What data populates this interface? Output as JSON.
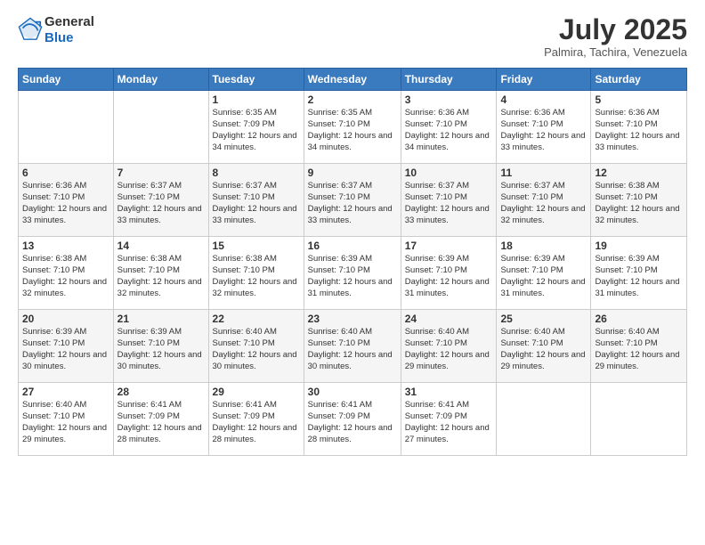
{
  "logo": {
    "general": "General",
    "blue": "Blue"
  },
  "title": "July 2025",
  "location": "Palmira, Tachira, Venezuela",
  "days_of_week": [
    "Sunday",
    "Monday",
    "Tuesday",
    "Wednesday",
    "Thursday",
    "Friday",
    "Saturday"
  ],
  "weeks": [
    [
      {
        "day": "",
        "info": ""
      },
      {
        "day": "",
        "info": ""
      },
      {
        "day": "1",
        "info": "Sunrise: 6:35 AM\nSunset: 7:09 PM\nDaylight: 12 hours and 34 minutes."
      },
      {
        "day": "2",
        "info": "Sunrise: 6:35 AM\nSunset: 7:10 PM\nDaylight: 12 hours and 34 minutes."
      },
      {
        "day": "3",
        "info": "Sunrise: 6:36 AM\nSunset: 7:10 PM\nDaylight: 12 hours and 34 minutes."
      },
      {
        "day": "4",
        "info": "Sunrise: 6:36 AM\nSunset: 7:10 PM\nDaylight: 12 hours and 33 minutes."
      },
      {
        "day": "5",
        "info": "Sunrise: 6:36 AM\nSunset: 7:10 PM\nDaylight: 12 hours and 33 minutes."
      }
    ],
    [
      {
        "day": "6",
        "info": "Sunrise: 6:36 AM\nSunset: 7:10 PM\nDaylight: 12 hours and 33 minutes."
      },
      {
        "day": "7",
        "info": "Sunrise: 6:37 AM\nSunset: 7:10 PM\nDaylight: 12 hours and 33 minutes."
      },
      {
        "day": "8",
        "info": "Sunrise: 6:37 AM\nSunset: 7:10 PM\nDaylight: 12 hours and 33 minutes."
      },
      {
        "day": "9",
        "info": "Sunrise: 6:37 AM\nSunset: 7:10 PM\nDaylight: 12 hours and 33 minutes."
      },
      {
        "day": "10",
        "info": "Sunrise: 6:37 AM\nSunset: 7:10 PM\nDaylight: 12 hours and 33 minutes."
      },
      {
        "day": "11",
        "info": "Sunrise: 6:37 AM\nSunset: 7:10 PM\nDaylight: 12 hours and 32 minutes."
      },
      {
        "day": "12",
        "info": "Sunrise: 6:38 AM\nSunset: 7:10 PM\nDaylight: 12 hours and 32 minutes."
      }
    ],
    [
      {
        "day": "13",
        "info": "Sunrise: 6:38 AM\nSunset: 7:10 PM\nDaylight: 12 hours and 32 minutes."
      },
      {
        "day": "14",
        "info": "Sunrise: 6:38 AM\nSunset: 7:10 PM\nDaylight: 12 hours and 32 minutes."
      },
      {
        "day": "15",
        "info": "Sunrise: 6:38 AM\nSunset: 7:10 PM\nDaylight: 12 hours and 32 minutes."
      },
      {
        "day": "16",
        "info": "Sunrise: 6:39 AM\nSunset: 7:10 PM\nDaylight: 12 hours and 31 minutes."
      },
      {
        "day": "17",
        "info": "Sunrise: 6:39 AM\nSunset: 7:10 PM\nDaylight: 12 hours and 31 minutes."
      },
      {
        "day": "18",
        "info": "Sunrise: 6:39 AM\nSunset: 7:10 PM\nDaylight: 12 hours and 31 minutes."
      },
      {
        "day": "19",
        "info": "Sunrise: 6:39 AM\nSunset: 7:10 PM\nDaylight: 12 hours and 31 minutes."
      }
    ],
    [
      {
        "day": "20",
        "info": "Sunrise: 6:39 AM\nSunset: 7:10 PM\nDaylight: 12 hours and 30 minutes."
      },
      {
        "day": "21",
        "info": "Sunrise: 6:39 AM\nSunset: 7:10 PM\nDaylight: 12 hours and 30 minutes."
      },
      {
        "day": "22",
        "info": "Sunrise: 6:40 AM\nSunset: 7:10 PM\nDaylight: 12 hours and 30 minutes."
      },
      {
        "day": "23",
        "info": "Sunrise: 6:40 AM\nSunset: 7:10 PM\nDaylight: 12 hours and 30 minutes."
      },
      {
        "day": "24",
        "info": "Sunrise: 6:40 AM\nSunset: 7:10 PM\nDaylight: 12 hours and 29 minutes."
      },
      {
        "day": "25",
        "info": "Sunrise: 6:40 AM\nSunset: 7:10 PM\nDaylight: 12 hours and 29 minutes."
      },
      {
        "day": "26",
        "info": "Sunrise: 6:40 AM\nSunset: 7:10 PM\nDaylight: 12 hours and 29 minutes."
      }
    ],
    [
      {
        "day": "27",
        "info": "Sunrise: 6:40 AM\nSunset: 7:10 PM\nDaylight: 12 hours and 29 minutes."
      },
      {
        "day": "28",
        "info": "Sunrise: 6:41 AM\nSunset: 7:09 PM\nDaylight: 12 hours and 28 minutes."
      },
      {
        "day": "29",
        "info": "Sunrise: 6:41 AM\nSunset: 7:09 PM\nDaylight: 12 hours and 28 minutes."
      },
      {
        "day": "30",
        "info": "Sunrise: 6:41 AM\nSunset: 7:09 PM\nDaylight: 12 hours and 28 minutes."
      },
      {
        "day": "31",
        "info": "Sunrise: 6:41 AM\nSunset: 7:09 PM\nDaylight: 12 hours and 27 minutes."
      },
      {
        "day": "",
        "info": ""
      },
      {
        "day": "",
        "info": ""
      }
    ]
  ]
}
